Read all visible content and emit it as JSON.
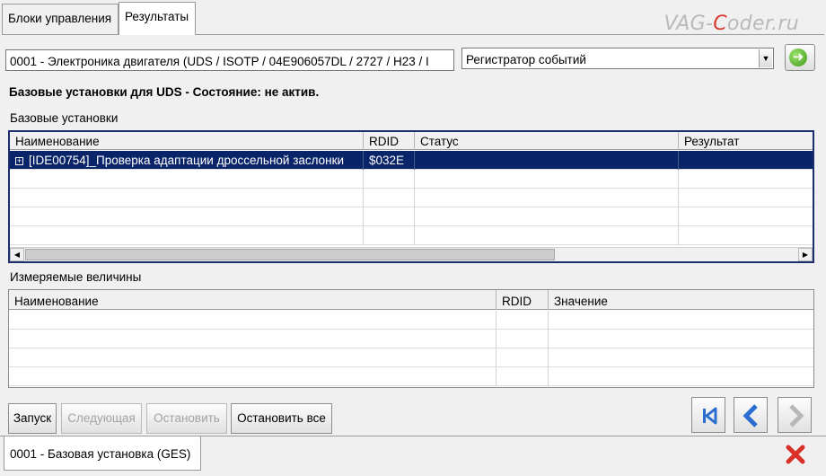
{
  "tabs": [
    {
      "label": "Блоки управления"
    },
    {
      "label": "Результаты"
    }
  ],
  "watermark": {
    "part1": "VAG-",
    "part2": "C",
    "part3": "oder.ru"
  },
  "module_field": {
    "value": "0001 - Электроника двигателя  (UDS / ISOTP / 04E906057DL / 2727 / H23 / I"
  },
  "function_select": {
    "value": "Регистратор событий"
  },
  "go_button": {
    "icon": "arrow-right-icon",
    "glyph": "➜",
    "color": "#3f9a1c"
  },
  "status_text": "Базовые установки для UDS - Состояние: не актив.",
  "basic_settings": {
    "label": "Базовые установки",
    "columns": [
      "Наименование",
      "RDID",
      "Статус",
      "Результат"
    ],
    "rows": [
      {
        "name": "[IDE00754]_Проверка адаптации дроссельной заслонки",
        "rdid": "$032E",
        "status": "",
        "result": ""
      }
    ]
  },
  "measured_values": {
    "label": "Измеряемые величины",
    "columns": [
      "Наименование",
      "RDID",
      "Значение"
    ]
  },
  "buttons": {
    "start": "Запуск",
    "next": "Следующая",
    "stop": "Остановить",
    "stop_all": "Остановить все"
  },
  "nav_icons": {
    "first": "skip-first-icon",
    "back": "chevron-left-icon",
    "forward": "chevron-right-icon",
    "accent": "#2a6fd0"
  },
  "footer": {
    "tab_label": "0001 - Базовая установка (GES)",
    "close_icon": "close-icon",
    "close_color": "#d9302a"
  }
}
